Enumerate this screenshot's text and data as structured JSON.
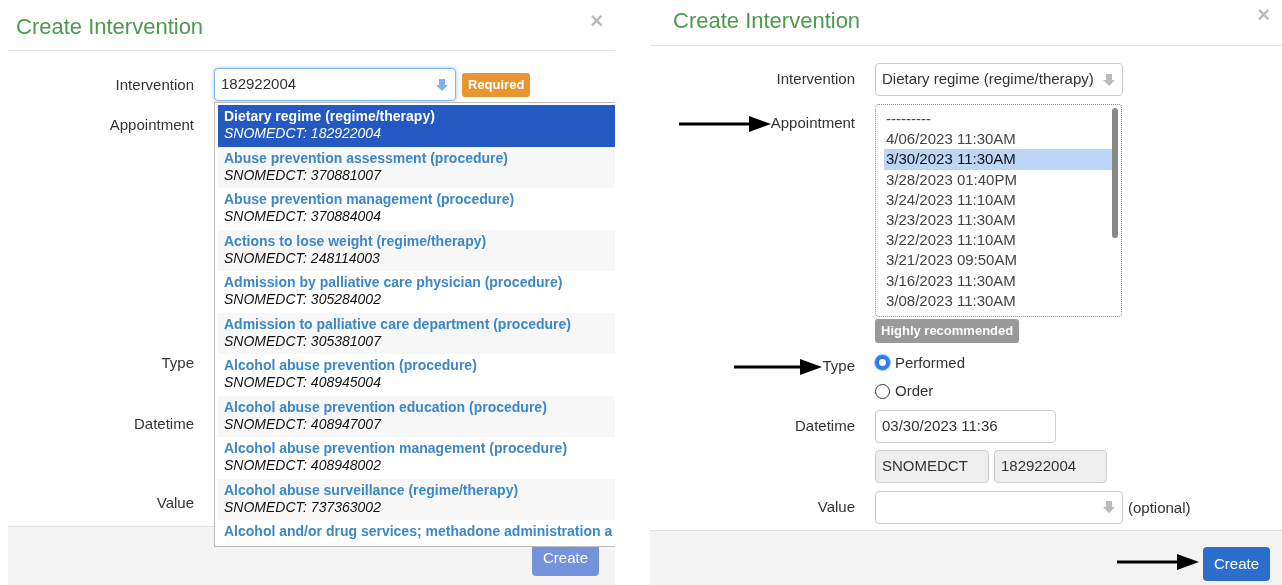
{
  "left": {
    "title": "Create Intervention",
    "close": "×",
    "intervention": {
      "label": "Intervention",
      "value": "182922004",
      "badge": "Required"
    },
    "labels": [
      "Appointment",
      "Type",
      "Datetime",
      "Value"
    ],
    "dropdown": [
      {
        "name": "Dietary regime (regime/therapy)",
        "code": "SNOMEDCT: 182922004",
        "selected": true
      },
      {
        "name": "Abuse prevention assessment (procedure)",
        "code": "SNOMEDCT: 370881007",
        "selected": false
      },
      {
        "name": "Abuse prevention management (procedure)",
        "code": "SNOMEDCT: 370884004",
        "selected": false
      },
      {
        "name": "Actions to lose weight (regime/therapy)",
        "code": "SNOMEDCT: 248114003",
        "selected": false
      },
      {
        "name": "Admission by palliative care physician (procedure)",
        "code": "SNOMEDCT: 305284002",
        "selected": false
      },
      {
        "name": "Admission to palliative care department (procedure)",
        "code": "SNOMEDCT: 305381007",
        "selected": false
      },
      {
        "name": "Alcohol abuse prevention (procedure)",
        "code": "SNOMEDCT: 408945004",
        "selected": false
      },
      {
        "name": "Alcohol abuse prevention education (procedure)",
        "code": "SNOMEDCT: 408947007",
        "selected": false
      },
      {
        "name": "Alcohol abuse prevention management (procedure)",
        "code": "SNOMEDCT: 408948002",
        "selected": false
      },
      {
        "name": "Alcohol abuse surveillance (regime/therapy)",
        "code": "SNOMEDCT: 737363002",
        "selected": false
      },
      {
        "name": "Alcohol and/or drug services; methadone administration a",
        "selected": false
      }
    ],
    "create": {
      "label": "Create",
      "disabled": true
    }
  },
  "right": {
    "title": "Create Intervention",
    "close": "×",
    "intervention": {
      "label": "Intervention",
      "value": "Dietary regime (regime/therapy)"
    },
    "appointment": {
      "label": "Appointment",
      "arrow": true,
      "badge": "Highly recommended",
      "options": [
        {
          "text": "---------",
          "selected": false
        },
        {
          "text": "4/06/2023 11:30AM",
          "selected": false
        },
        {
          "text": "3/30/2023 11:30AM",
          "selected": true
        },
        {
          "text": "3/28/2023 01:40PM",
          "selected": false
        },
        {
          "text": "3/24/2023 11:10AM",
          "selected": false
        },
        {
          "text": "3/23/2023 11:30AM",
          "selected": false
        },
        {
          "text": "3/22/2023 11:10AM",
          "selected": false
        },
        {
          "text": "3/21/2023 09:50AM",
          "selected": false
        },
        {
          "text": "3/16/2023 11:30AM",
          "selected": false
        },
        {
          "text": "3/08/2023 11:30AM",
          "selected": false
        }
      ]
    },
    "type": {
      "label": "Type",
      "arrow": true,
      "options": [
        {
          "label": "Performed",
          "selected": true
        },
        {
          "label": "Order",
          "selected": false
        }
      ]
    },
    "datetime": {
      "label": "Datetime",
      "value": "03/30/2023 11:36"
    },
    "codes": [
      "SNOMEDCT",
      "182922004"
    ],
    "value": {
      "label": "Value",
      "suffix": "(optional)"
    },
    "create": {
      "label": "Create",
      "disabled": false,
      "arrow": true
    }
  }
}
